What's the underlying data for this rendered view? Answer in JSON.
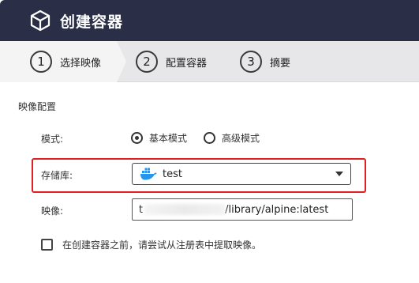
{
  "window": {
    "title": "创建容器",
    "icon": "cube-icon",
    "header_color": "#2a2f47"
  },
  "steps": [
    {
      "number": "1",
      "label": "选择映像",
      "active": true
    },
    {
      "number": "2",
      "label": "配置容器",
      "active": false
    },
    {
      "number": "3",
      "label": "摘要",
      "active": false
    }
  ],
  "form": {
    "section_title": "映像配置",
    "mode": {
      "label": "模式:",
      "options": [
        "基本模式",
        "高级模式"
      ],
      "selected": "基本模式"
    },
    "repository": {
      "label": "存储库:",
      "value": "test",
      "icon": "docker-icon"
    },
    "image": {
      "label": "映像:",
      "value_prefix": "t",
      "value_suffix": "/library/alpine:latest"
    },
    "pull_checkbox": {
      "label": "在创建容器之前，请尝试从注册表中提取映像。",
      "checked": false
    }
  },
  "highlight_color": "#e02020"
}
